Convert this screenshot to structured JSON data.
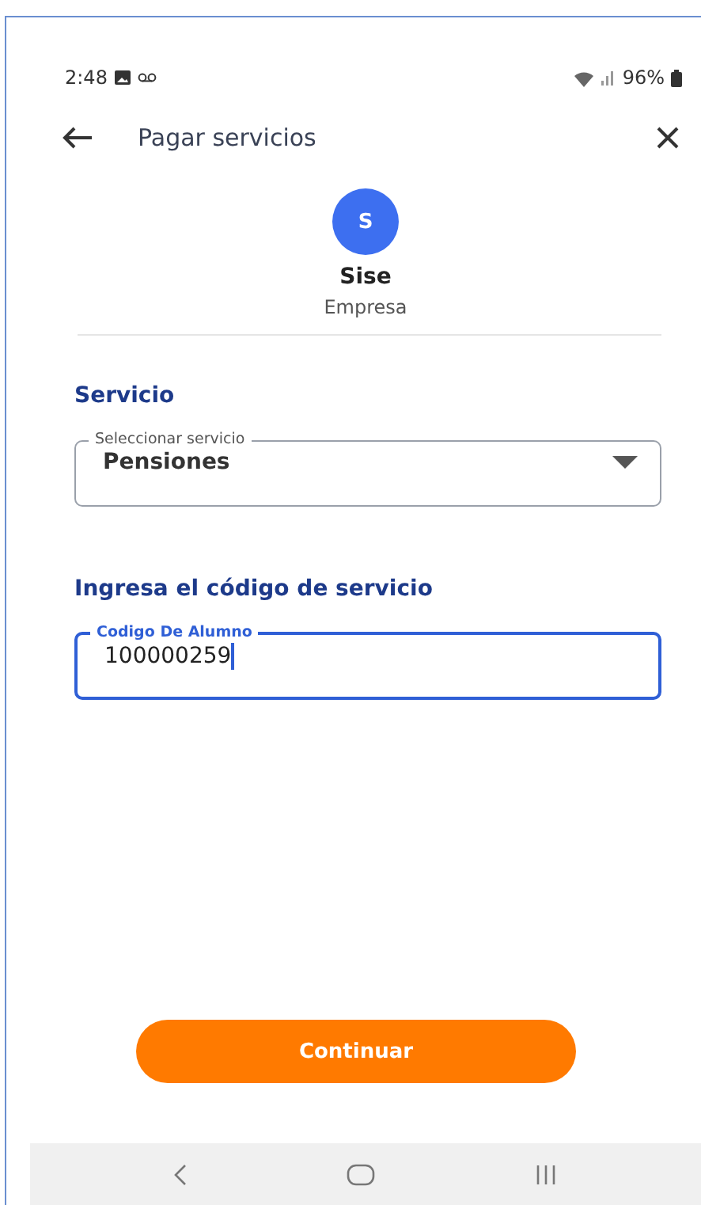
{
  "status_bar": {
    "time": "2:48",
    "battery": "96%"
  },
  "app_bar": {
    "title": "Pagar servicios"
  },
  "company": {
    "initial": "S",
    "name": "Sise",
    "type": "Empresa"
  },
  "service_section": {
    "heading": "Servicio",
    "select": {
      "label": "Seleccionar servicio",
      "value": "Pensiones"
    }
  },
  "code_section": {
    "heading": "Ingresa el código de servicio",
    "input": {
      "label": "Codigo De Alumno",
      "value": "100000259",
      "focused": true
    }
  },
  "primary_button": {
    "label": "Continuar"
  }
}
